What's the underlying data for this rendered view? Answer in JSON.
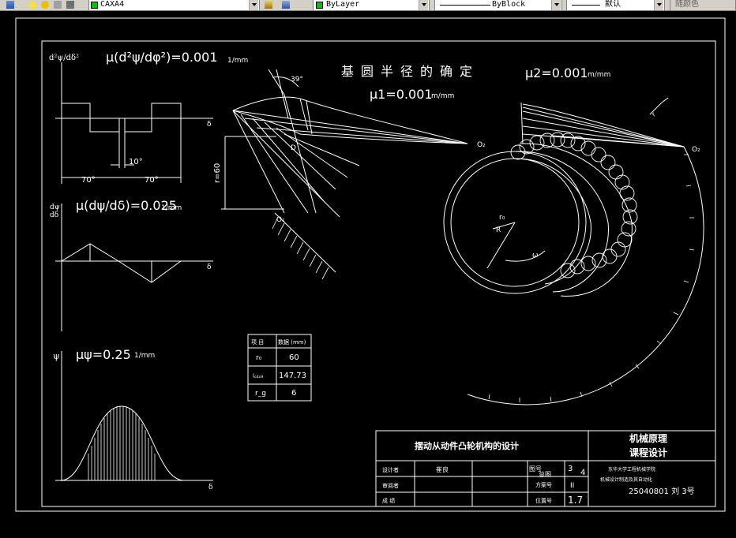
{
  "toolbar": {
    "layer_name": "CAXA4",
    "color_value": "ByLayer",
    "linetype_value": "ByBlock",
    "lineweight_value": "默认",
    "plotstyle_value": "随颜色",
    "colors": {
      "layer_swatch": "#00c000",
      "bylayer_swatch": "#00c000"
    }
  },
  "drawing": {
    "title": "基圆半径的确定",
    "mu_d2": "μ(d²ψ/dφ²)=0.001",
    "mu_d2_unit": "1/mm",
    "mu_dpsi": "μ(dψ/dδ)=0.025",
    "mu_dpsi_unit": "1/mm",
    "mu_psi": "μψ=0.25",
    "mu_psi_unit": "1/mm",
    "mu1": "μ1=0.001",
    "mu1_unit": "m/mm",
    "mu2": "μ2=0.001",
    "mu2_unit": "m/mm",
    "axis_d2": "d²ψ/dδ²",
    "axis_dpsi_top": "dψ",
    "axis_dpsi_bottom": "dδ",
    "axis_psi": "ψ",
    "axis_delta": "δ",
    "dim_70_left": "70°",
    "dim_70_right": "70°",
    "dim_10": "10°",
    "angle_39": "39°",
    "r60": "r=60",
    "label_D": "D",
    "label_O1": "O₁",
    "label_O2": "O₂",
    "label_Oa": "O₂",
    "label_r0": "r₀",
    "label_R": "R",
    "label_omega": "ω",
    "label_rg_arrow": "r"
  },
  "param_table": {
    "header_col1": "项 目",
    "header_col2": "数据 (mm)",
    "rows": [
      {
        "label": "r₀",
        "value": "60"
      },
      {
        "label": "lₒ₂ₒ₉",
        "value": "147.73"
      },
      {
        "label": "r_g",
        "value": "6"
      }
    ]
  },
  "title_block": {
    "design_title": "摆动从动件凸轮机构的设计",
    "course_line1": "机械原理",
    "course_line2": "课程设计",
    "row_designer": "设计者",
    "designer_name": "崔良",
    "row_reviewer": "审阅者",
    "row_grade": "成 绩",
    "label_figure": "图号",
    "label_total": "总图",
    "val_3": "3",
    "val_4": "4",
    "label_plan": "方案号",
    "val_plan": "II",
    "label_position": "位置号",
    "val_position": "1.7",
    "school_line1": "东华大学工程机械学院",
    "school_line2": "机械设计制造及其自动化",
    "student_id": "25040801 刘 3号"
  }
}
